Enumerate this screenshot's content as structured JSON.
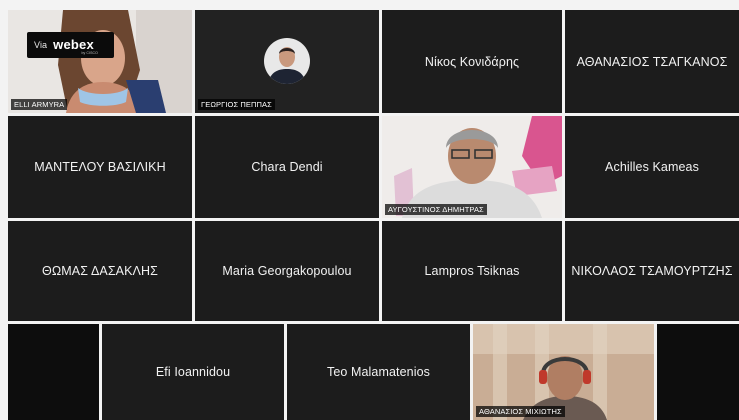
{
  "badge": {
    "via": "Via",
    "brand": "webex",
    "sub": "by CISCO"
  },
  "participants": [
    {
      "id": "elli",
      "label": "ELLI ARMYRA"
    },
    {
      "id": "georgios",
      "label": "ΓΕΩΡΓΙΟΣ ΠΕΠΠΑΣ"
    },
    {
      "id": "nikos",
      "label": "Νίκος Κονιδάρης"
    },
    {
      "id": "athanasios-t",
      "label": "ΑΘΑΝΑΣΙΟΣ ΤΣΑΓΚΑΝΟΣ"
    },
    {
      "id": "mantelou",
      "label": "ΜΑΝΤΕΛΟΥ ΒΑΣΙΛΙΚΗ"
    },
    {
      "id": "chara",
      "label": "Chara Dendi"
    },
    {
      "id": "avgoustinos",
      "label": "ΑΥΓΟΥΣΤΙΝΟΣ ΔΗΜΗΤΡΑΣ"
    },
    {
      "id": "achilles",
      "label": "Achilles Kameas"
    },
    {
      "id": "thomas",
      "label": "ΘΩΜΑΣ ΔΑΣΑΚΛΗΣ"
    },
    {
      "id": "maria",
      "label": "Maria Georgakopoulou"
    },
    {
      "id": "lampros",
      "label": "Lampros Tsiknas"
    },
    {
      "id": "nikolaos",
      "label": "ΝΙΚΟΛΑΟΣ ΤΣΑΜΟΥΡΤΖΗΣ"
    },
    {
      "id": "efi",
      "label": "Efi Ioannidou"
    },
    {
      "id": "teo",
      "label": "Teo Malamatenios"
    },
    {
      "id": "athanasios-m",
      "label": "ΑΘΑΝΑΣΙΟΣ ΜΙΧΙΩΤΗΣ"
    }
  ]
}
